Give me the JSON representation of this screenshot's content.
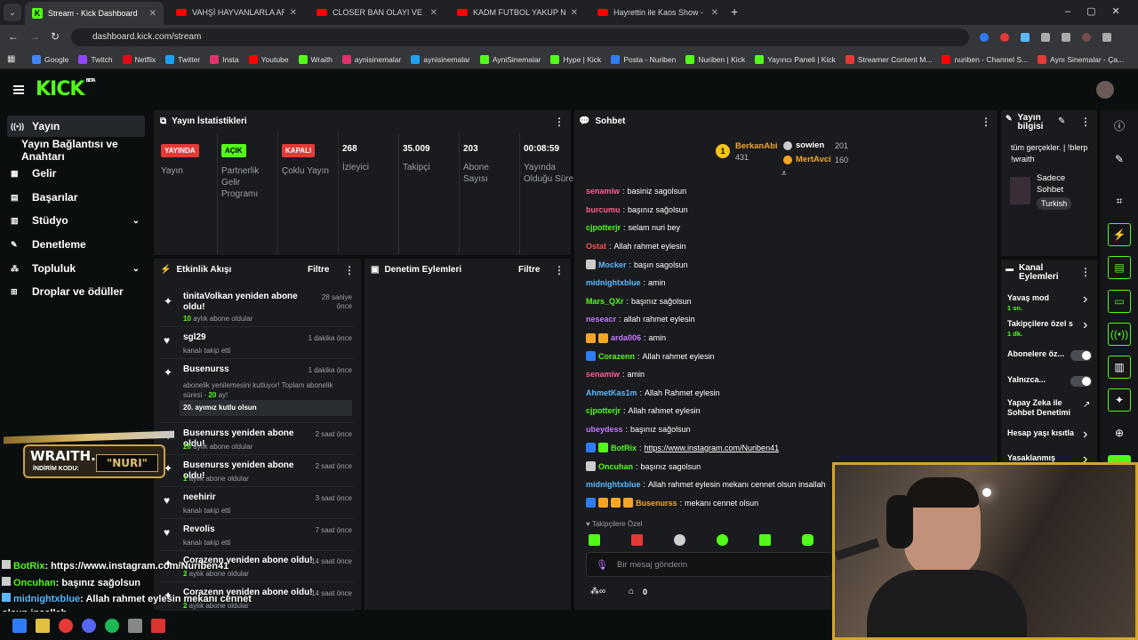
{
  "tabs": [
    {
      "label": "Stream - Kick Dashboard",
      "icon": "kick"
    },
    {
      "label": "VAHŞİ HAYVANLARLA ARKADAŞ",
      "icon": "youtube"
    },
    {
      "label": "CLOSER BAN OLAYI VE SONRA",
      "icon": "youtube"
    },
    {
      "label": "KADM FUTBOL YAKUP NE KADAR",
      "icon": "youtube"
    },
    {
      "label": "Hayrettin ile Kaos Show - 2.Sez",
      "icon": "youtube"
    }
  ],
  "url": "dashboard.kick.com/stream",
  "bookmarks": [
    "Google",
    "Twitch",
    "Netflix",
    "Twitter",
    "Insta",
    "Youtube",
    "Wraith",
    "aynisinemalar",
    "aynisinemalar",
    "AyniSinemalar",
    "Hype | Kick",
    "Posta - Nuriben",
    "Nuriben | Kick",
    "Yayıncı Paneli | Kick",
    "Streamer Content M...",
    "nuriben - Channel S...",
    "Aynı Sinemalar - Ça..."
  ],
  "brand": {
    "logo": "KICK",
    "beta": "BETA",
    "accent": "#53fc18"
  },
  "sidebar": [
    {
      "label": "Yayın",
      "icon": "broadcast-icon",
      "active": true
    },
    {
      "label": "Yayın Bağlantısı ve Anahtarı",
      "icon": ""
    },
    {
      "label": "Gelir",
      "icon": "revenue-icon"
    },
    {
      "label": "Başarılar",
      "icon": "achievements-icon"
    },
    {
      "label": "Stüdyo",
      "icon": "studio-icon",
      "chevron": true
    },
    {
      "label": "Denetleme",
      "icon": "moderation-icon"
    },
    {
      "label": "Topluluk",
      "icon": "community-icon",
      "chevron": true
    },
    {
      "label": "Droplar ve ödüller",
      "icon": "drops-icon"
    }
  ],
  "stats": {
    "title": "Yayın İstatistikleri",
    "items": [
      {
        "badge": "YAYINDA",
        "badge_color": "#e53935",
        "label": "Yayın"
      },
      {
        "badge": "AÇIK",
        "badge_color": "#53fc18",
        "label": "Partnerlik Gelir Programı"
      },
      {
        "badge": "KAPALI",
        "badge_color": "#e53935",
        "label": "Çoklu Yayın"
      },
      {
        "value": "268",
        "label": "İzleyici"
      },
      {
        "value": "35.009",
        "label": "Takipçi"
      },
      {
        "value": "203",
        "label": "Abone Sayısı"
      },
      {
        "value": "00:08:59",
        "label": "Yayında Olduğu Süre"
      }
    ]
  },
  "activity": {
    "title": "Etkinlik Akışı",
    "filter": "Filtre",
    "events": [
      {
        "icon": "sparkle-icon",
        "title": "tinitaVolkan yeniden abone oldu!",
        "sub_num": "10",
        "sub": " aylık abone oldular",
        "time": "28 saniye önce"
      },
      {
        "icon": "heart-icon",
        "title": "sgl29",
        "sub": "kanalı takip etti",
        "time": "1 dakika önce"
      },
      {
        "icon": "sparkle-icon",
        "title": "Busenurss",
        "sub": "abonelik yenilemesini kutluyor! Toplam abonelik süresi - ",
        "sub_num": "20",
        "sub2": " ay!",
        "message": "20. ayımız kutlu olsun",
        "time": "1 dakika önce"
      },
      {
        "icon": "sparkle-icon",
        "title": "Busenurss yeniden abone oldu!",
        "sub_num": "20",
        "sub": " aylık abone oldular",
        "time": "2 saat önce"
      },
      {
        "icon": "sparkle-icon",
        "title": "Busenurss yeniden abone oldu!",
        "sub_num": "1",
        "sub": " aylık abone oldular",
        "time": "2 saat önce"
      },
      {
        "icon": "heart-icon",
        "title": "neehirir",
        "sub": "kanalı takip etti",
        "time": "3 saat önce"
      },
      {
        "icon": "heart-icon",
        "title": "Revolis",
        "sub": "kanalı takip etti",
        "time": "7 saat önce"
      },
      {
        "icon": "sparkle-icon",
        "title": "Corazenn yeniden abone oldu!",
        "sub_num": "2",
        "sub": " aylık abone oldular",
        "time": "14 saat önce"
      },
      {
        "icon": "sparkle-icon",
        "title": "Corazenn yeniden abone oldu!",
        "sub_num": "2",
        "sub": " aylık abone oldular",
        "time": "14 saat önce"
      }
    ]
  },
  "moderation": {
    "title": "Denetim Eylemleri",
    "filter": "Filtre"
  },
  "chat": {
    "title": "Sohbet",
    "leaders": [
      {
        "rank": "1",
        "name": "BerkanAbi",
        "count": "431",
        "color": "#f5a623"
      },
      {
        "rank": "",
        "name": "sowien",
        "count": "201",
        "color": "#ffffff"
      },
      {
        "rank": "",
        "name": "MertAvci",
        "count": "160",
        "color": "#f5a623"
      }
    ],
    "messages": [
      {
        "user": "senamiw",
        "color": "#ff5c8a",
        "text": "basiniz sagolsun"
      },
      {
        "user": "burcumu",
        "color": "#ff5c8a",
        "text": "başınız sağolsun"
      },
      {
        "user": "cjpotterjr",
        "color": "#53fc18",
        "text": "selam nuri bey"
      },
      {
        "user": "Ostat",
        "color": "#ff4d4d",
        "text": "Allah rahmet eylesin"
      },
      {
        "user": "Mocker",
        "color": "#5bb8ff",
        "text": "başın sagolsun",
        "badges": [
          "#cccccc"
        ]
      },
      {
        "user": "midnightxblue",
        "color": "#5bb8ff",
        "text": "amin"
      },
      {
        "user": "Mars_QXr",
        "color": "#53fc18",
        "text": "başınız sağolsun"
      },
      {
        "user": "neseacr",
        "color": "#c678ff",
        "text": "allah rahmet eylesin"
      },
      {
        "user": "arda006",
        "color": "#c678ff",
        "text": "amin",
        "badges": [
          "#f5a623",
          "#f5a623"
        ]
      },
      {
        "user": "Corazenn",
        "color": "#53fc18",
        "text": "Allah rahmet eylesin",
        "badges": [
          "#2f7cf6"
        ]
      },
      {
        "user": "senamiw",
        "color": "#ff5c8a",
        "text": "amin"
      },
      {
        "user": "AhmetKas1m",
        "color": "#5bb8ff",
        "text": "Allah Rahmet eylesin"
      },
      {
        "user": "cjpotterjr",
        "color": "#53fc18",
        "text": "Allah rahmet eylesin"
      },
      {
        "user": "ubeydess",
        "color": "#c678ff",
        "text": "başınız sağolsun"
      },
      {
        "user": "BotRix",
        "color": "#53fc18",
        "text": "https://www.instagram.com/Nuriben41",
        "badges": [
          "#2f7cf6",
          "#53fc18"
        ],
        "link": true
      },
      {
        "user": "Oncuhan",
        "color": "#53fc18",
        "text": "başınız sagolsun",
        "badges": [
          "#cccccc"
        ]
      },
      {
        "user": "midnightxblue",
        "color": "#5bb8ff",
        "text": "Allah rahmet eylesin mekanı cennet olsun insallah"
      },
      {
        "user": "Busenurss",
        "color": "#f5a623",
        "text": "mekanı cennet olsun",
        "badges": [
          "#2f7cf6",
          "#f5a623",
          "#f5a623",
          "#f5a623"
        ]
      }
    ],
    "followers_only": "Takipçilere Özel",
    "placeholder": "Bir mesaj gönderin",
    "count": "0"
  },
  "stream_info": {
    "title": "Yayın bilgisi",
    "stream_title": "tüm gerçekler. | !blerp !wraith",
    "category": "Sadece Sohbet",
    "language": "Turkish"
  },
  "channel_actions": {
    "title": "Kanal Eylemleri",
    "items": [
      {
        "label": "Yavaş mod",
        "sub": "1 sn.",
        "control": "chevron"
      },
      {
        "label": "Takipçilere özel s",
        "sub": "1 dk.",
        "control": "chevron"
      },
      {
        "label": "Abonelere öz...",
        "control": "toggle"
      },
      {
        "label": "Yalnızca...",
        "control": "toggle"
      },
      {
        "label": "Yapay Zeka ile Sohbet Denetimi",
        "control": "external"
      },
      {
        "label": "Hesap yaşı kısıtla",
        "control": "chevron"
      },
      {
        "label": "Yasaklanmış kelin",
        "control": "chevron"
      }
    ]
  },
  "overlay": {
    "banner": [
      "WRAITH.",
      "NURI",
      "İNDİRİM KODU:"
    ],
    "chat": [
      {
        "user": "BotRix",
        "color": "#53fc18",
        "text": ": https://www.instagram.com/Nuriben41"
      },
      {
        "user": "Oncuhan",
        "color": "#53fc18",
        "text": ": başınız sağolsun"
      },
      {
        "user": "midnightxblue",
        "color": "#5bb8ff",
        "text": ": Allah rahmet eylesin mekanı cennet"
      },
      {
        "user": "",
        "color": "#ffffff",
        "text": "olsun insallah"
      },
      {
        "user": "Busenurss",
        "color": "#f5a623",
        "text": ": mekanı cennet olsun"
      }
    ]
  }
}
